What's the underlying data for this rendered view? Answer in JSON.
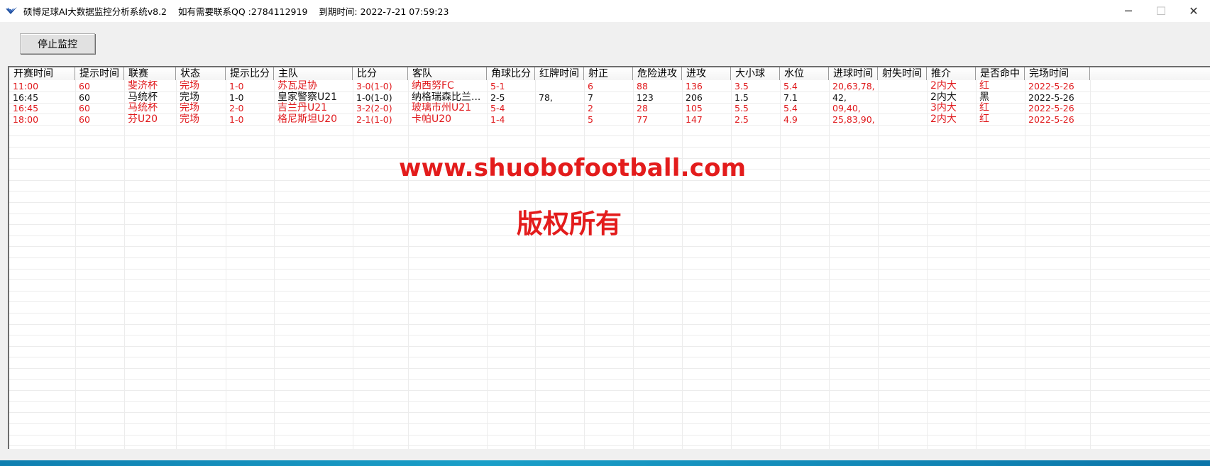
{
  "window": {
    "title_app": "硕博足球AI大数据监控分析系统v8.2",
    "title_contact": "如有需要联系QQ :2784112919",
    "title_expiry": "到期时间:  2022-7-21 07:59:23",
    "minimize_glyph": "─",
    "maximize_glyph": "☐",
    "close_glyph": "✕"
  },
  "toolbar": {
    "stop_label": "停止监控"
  },
  "grid": {
    "columns": [
      "开赛时间",
      "提示时间",
      "联赛",
      "状态",
      "提示比分",
      "主队",
      "比分",
      "客队",
      "角球比分",
      "红牌时间",
      "射正",
      "危险进攻",
      "进攻",
      "大小球",
      "水位",
      "进球时间",
      "射失时间",
      "推介",
      "是否命中",
      "完场时间"
    ],
    "rows": [
      {
        "color": "red",
        "cells": [
          "11:00",
          "60",
          "斐济杯",
          "完场",
          "1-0",
          "苏瓦足协",
          "3-0(1-0)",
          "纳西努FC",
          "5-1",
          "",
          "6",
          "88",
          "136",
          "3.5",
          "5.4",
          "20,63,78,",
          "",
          "2内大",
          "红",
          "2022-5-26"
        ]
      },
      {
        "color": "black",
        "cells": [
          "16:45",
          "60",
          "马统杯",
          "完场",
          "1-0",
          "皇家警察U21",
          "1-0(1-0)",
          "纳格瑞森比兰...",
          "2-5",
          "78,",
          "7",
          "123",
          "206",
          "1.5",
          "7.1",
          "42,",
          "",
          "2内大",
          "黑",
          "2022-5-26"
        ]
      },
      {
        "color": "red",
        "cells": [
          "16:45",
          "60",
          "马统杯",
          "完场",
          "2-0",
          "吉兰丹U21",
          "3-2(2-0)",
          "玻璃市州U21",
          "5-4",
          "",
          "2",
          "28",
          "105",
          "5.5",
          "5.4",
          "09,40,",
          "",
          "3内大",
          "红",
          "2022-5-26"
        ]
      },
      {
        "color": "red",
        "cells": [
          "18:00",
          "60",
          "芬U20",
          "完场",
          "1-0",
          "格尼斯坦U20",
          "2-1(1-0)",
          "卡帕U20",
          "1-4",
          "",
          "5",
          "77",
          "147",
          "2.5",
          "4.9",
          "25,83,90,",
          "",
          "2内大",
          "红",
          "2022-5-26"
        ]
      }
    ]
  },
  "watermark": {
    "url": "www.shuobofootball.com",
    "rights": "版权所有"
  },
  "colors": {
    "red": "#e0191c",
    "black": "#111111",
    "taskbar": "#1a9fc8"
  }
}
